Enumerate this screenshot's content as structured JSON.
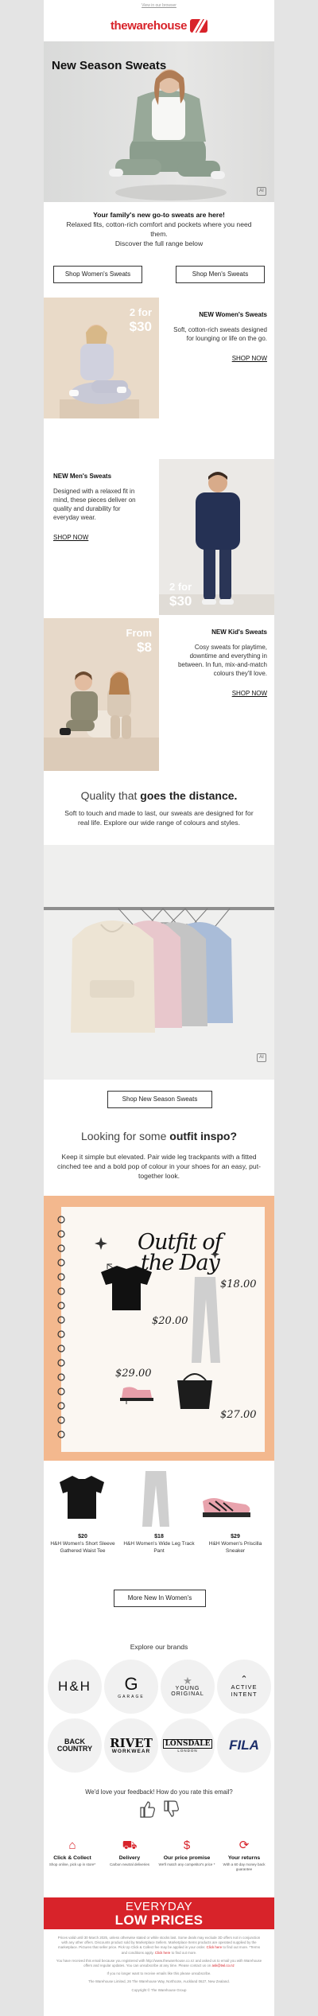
{
  "preheader": {
    "view_online": "View in our browser"
  },
  "logo": {
    "brand_a": "the",
    "brand_b": "warehouse"
  },
  "hero": {
    "title": "New Season Sweats",
    "ai_tag": "AI"
  },
  "intro": {
    "headline": "Your family's new go-to sweats are here!",
    "body": "Relaxed fits, cotton-rich comfort and pockets where you need them.",
    "cta_line": "Discover the full range below",
    "btn_women": "Shop Women's Sweats",
    "btn_men": "Shop Men's Sweats"
  },
  "tiles": [
    {
      "badge_a": "2 for",
      "badge_b": "$30",
      "title": "NEW Women's Sweats",
      "body": "Soft, cotton-rich sweats designed for lounging or life on the go.",
      "link": "SHOP NOW"
    },
    {
      "badge_a": "2 for",
      "badge_b": "$30",
      "title": "NEW Men's Sweats",
      "body": "Designed with a relaxed fit in mind, these pieces deliver on quality and durability for everyday wear.",
      "link": "SHOP NOW"
    },
    {
      "badge_a": "From",
      "badge_b": "$8",
      "title": "NEW Kid's Sweats",
      "body": "Cosy sweats for playtime, downtime and everything in between. In fun, mix-and-match colours they'll love.",
      "link": "SHOP NOW"
    }
  ],
  "quality": {
    "title_a": "Quality that ",
    "title_b": "goes the distance.",
    "body": "Soft to touch and made to last, our sweats are designed for for real life. Explore our wide range of colours and styles.",
    "btn": "Shop New Season Sweats",
    "ai_tag": "AI"
  },
  "inspo": {
    "title_a": "Looking for some ",
    "title_b": "outfit inspo?",
    "body": "Keep it simple but elevated. Pair wide leg trackpants with a fitted cinched tee and a bold pop of colour in your shoes for an easy, put-together look.",
    "board_title_a": "Outfit of",
    "board_title_b": "the Day",
    "prices": [
      "$18.00",
      "$20.00",
      "$29.00",
      "$27.00"
    ]
  },
  "products": [
    {
      "price": "$20",
      "name": "H&H Women's Short Sleeve Gathered Waist Tee"
    },
    {
      "price": "$18",
      "name": "H&H Women's Wide Leg Track Pant"
    },
    {
      "price": "$29",
      "name": "H&H Women's Priscilla Sneaker"
    }
  ],
  "more_btn": "More New In Women's",
  "brands": {
    "title": "Explore our brands",
    "items": [
      {
        "line1": "H&H",
        "line2": ""
      },
      {
        "line1": "G",
        "line2": "GARAGE"
      },
      {
        "line1": "YOUNG",
        "line2": "ORIGINAL"
      },
      {
        "line1": "ACTIVE",
        "line2": "INTENT"
      },
      {
        "line1": "BACK",
        "line2": "COUNTRY"
      },
      {
        "line1": "RIVET",
        "line2": "WORKWEAR"
      },
      {
        "line1": "LONSDALE",
        "line2": "LONDON"
      },
      {
        "line1": "FILA",
        "line2": ""
      }
    ]
  },
  "feedback": {
    "question": "We'd love your feedback! How do you rate this email?"
  },
  "perks": [
    {
      "title": "Click & Collect",
      "desc": "Shop online, pick up in store*"
    },
    {
      "title": "Delivery",
      "desc": "Carbon neutral deliveries"
    },
    {
      "title": "Our price promise",
      "desc": "We'll match any competitor's price *"
    },
    {
      "title": "Your returns",
      "desc": "With a 60 day money back guarantee"
    }
  ],
  "banner": {
    "line1": "EVERYDAY",
    "line2": "LOW PRICES"
  },
  "fine_print": {
    "p1": "Prices valid until 30 March 2025, unless otherwise stated or while stocks last. Some deals may exclude 3D offers not in conjunction with any other offers. Discounts product sold by Marketplace Sellers. Marketplace Items products are operated supplied by the marketplace. Pictures that seller price. Pick Up Click & Collect fee may be applied in your order.",
    "link1": "Click here",
    "p1b": "to find out more. *Terms and conditions apply.",
    "link2": "Click here",
    "p1c": "to find out more.",
    "p2": "You have received this email because you registered with http://www.thewarehouse.co.nz and asked us to email you with Warehouse offers and regular updates. You can unsubscribe at any time. Please contact us on",
    "email": "ask@twl.co.nz",
    "p3": "If you no longer want to receive emails like this please unsubscribe.",
    "p4": "The Warehouse Limited, 26 The Warehouse Way, Northcote, Auckland 0627, New Zealand.",
    "p5": "Copyright © The Warehouse Group"
  },
  "colors": {
    "brand_red": "#d8232a",
    "hoodie_cream": "#ede4d4",
    "hoodie_pink": "#e8c7cc",
    "hoodie_grey": "#c4c4c4",
    "hoodie_blue": "#a9bcd8"
  }
}
